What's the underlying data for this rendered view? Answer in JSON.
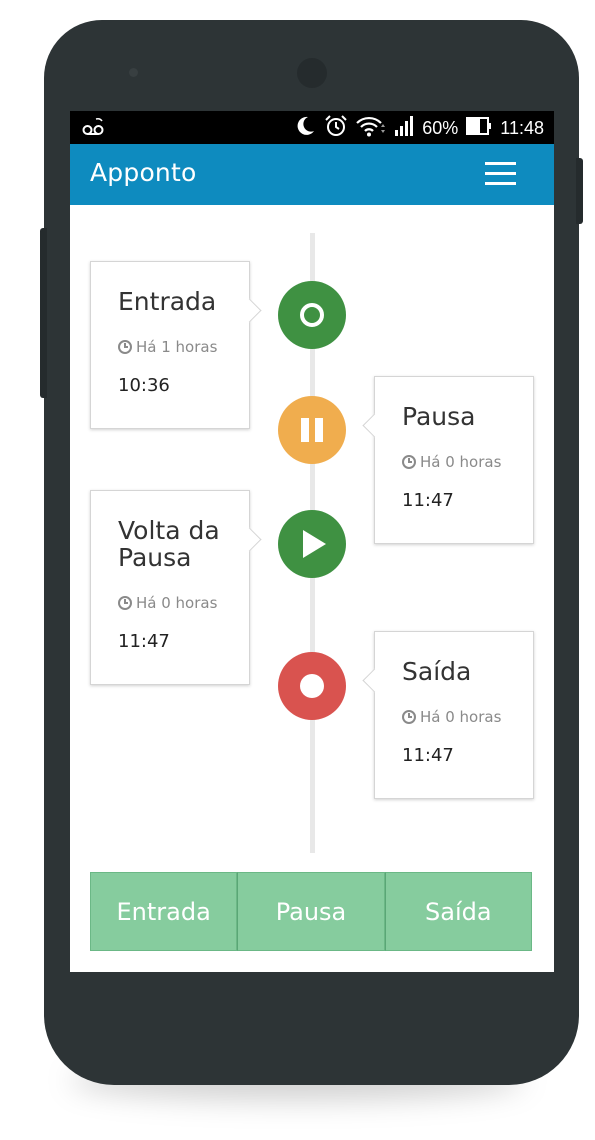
{
  "status_bar": {
    "battery": "60%",
    "time": "11:48",
    "icons": [
      "voicemail-icon",
      "moon-icon",
      "alarm-icon",
      "wifi-icon",
      "signal-icon",
      "battery-icon"
    ]
  },
  "app_bar": {
    "title": "Apponto",
    "menu_icon": "hamburger-menu-icon"
  },
  "timeline": [
    {
      "title": "Entrada",
      "ago": "Há 1 horas",
      "time": "10:36",
      "icon": "circle-outline-icon",
      "color": "#3f9142"
    },
    {
      "title": "Pausa",
      "ago": "Há 0 horas",
      "time": "11:47",
      "icon": "pause-icon",
      "color": "#f0ad4e"
    },
    {
      "title": "Volta da Pausa",
      "ago": "Há 0 horas",
      "time": "11:47",
      "icon": "play-icon",
      "color": "#3f9142"
    },
    {
      "title": "Saída",
      "ago": "Há 0 horas",
      "time": "11:47",
      "icon": "stop-dot-icon",
      "color": "#d9534f"
    }
  ],
  "actions": {
    "entrada": "Entrada",
    "pausa": "Pausa",
    "saida": "Saída",
    "color": "#86cc9e"
  }
}
